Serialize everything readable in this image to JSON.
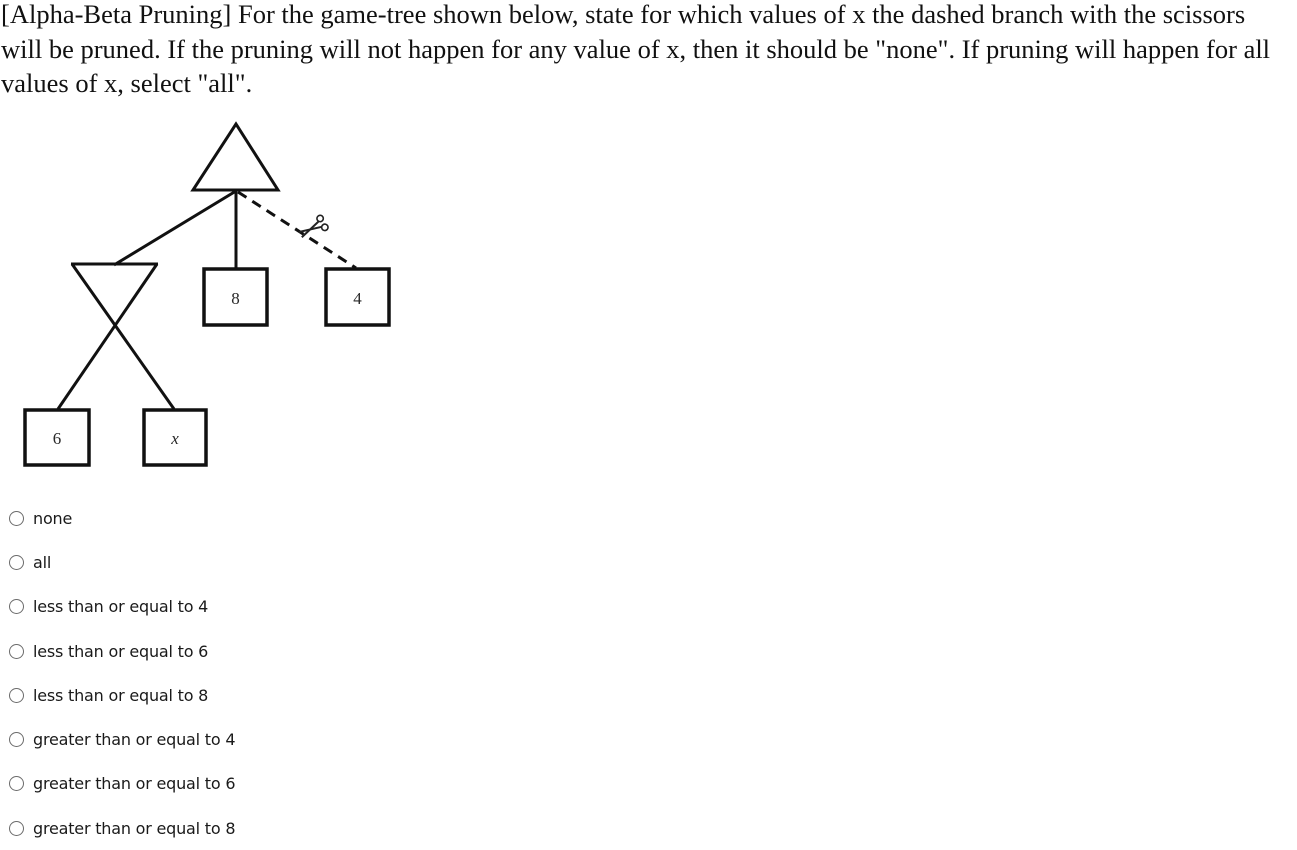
{
  "question": {
    "text": "[Alpha-Beta Pruning] For the game-tree shown below, state for which values of x the dashed branch with the scissors will be pruned. If the pruning will not happen for any value of x, then it should be \"none\". If pruning will happen for all values of x, select \"all\"."
  },
  "diagram": {
    "root": {
      "type": "max",
      "shape": "triangle-up"
    },
    "min_node": {
      "type": "min",
      "shape": "triangle-down"
    },
    "leaves": {
      "min_left": "6",
      "min_right": "x",
      "root_middle": "8",
      "root_right": "4"
    },
    "pruned_branch": {
      "style": "dashed",
      "icon": "scissors-icon",
      "target": "4"
    }
  },
  "options": [
    {
      "label": "none",
      "selected": false
    },
    {
      "label": "all",
      "selected": false
    },
    {
      "label": "less than or equal to 4",
      "selected": false
    },
    {
      "label": "less than or equal to 6",
      "selected": false
    },
    {
      "label": "less than or equal to 8",
      "selected": false
    },
    {
      "label": "greater than or equal to 4",
      "selected": false
    },
    {
      "label": "greater than or equal to 6",
      "selected": false
    },
    {
      "label": "greater than or equal to 8",
      "selected": false
    }
  ]
}
